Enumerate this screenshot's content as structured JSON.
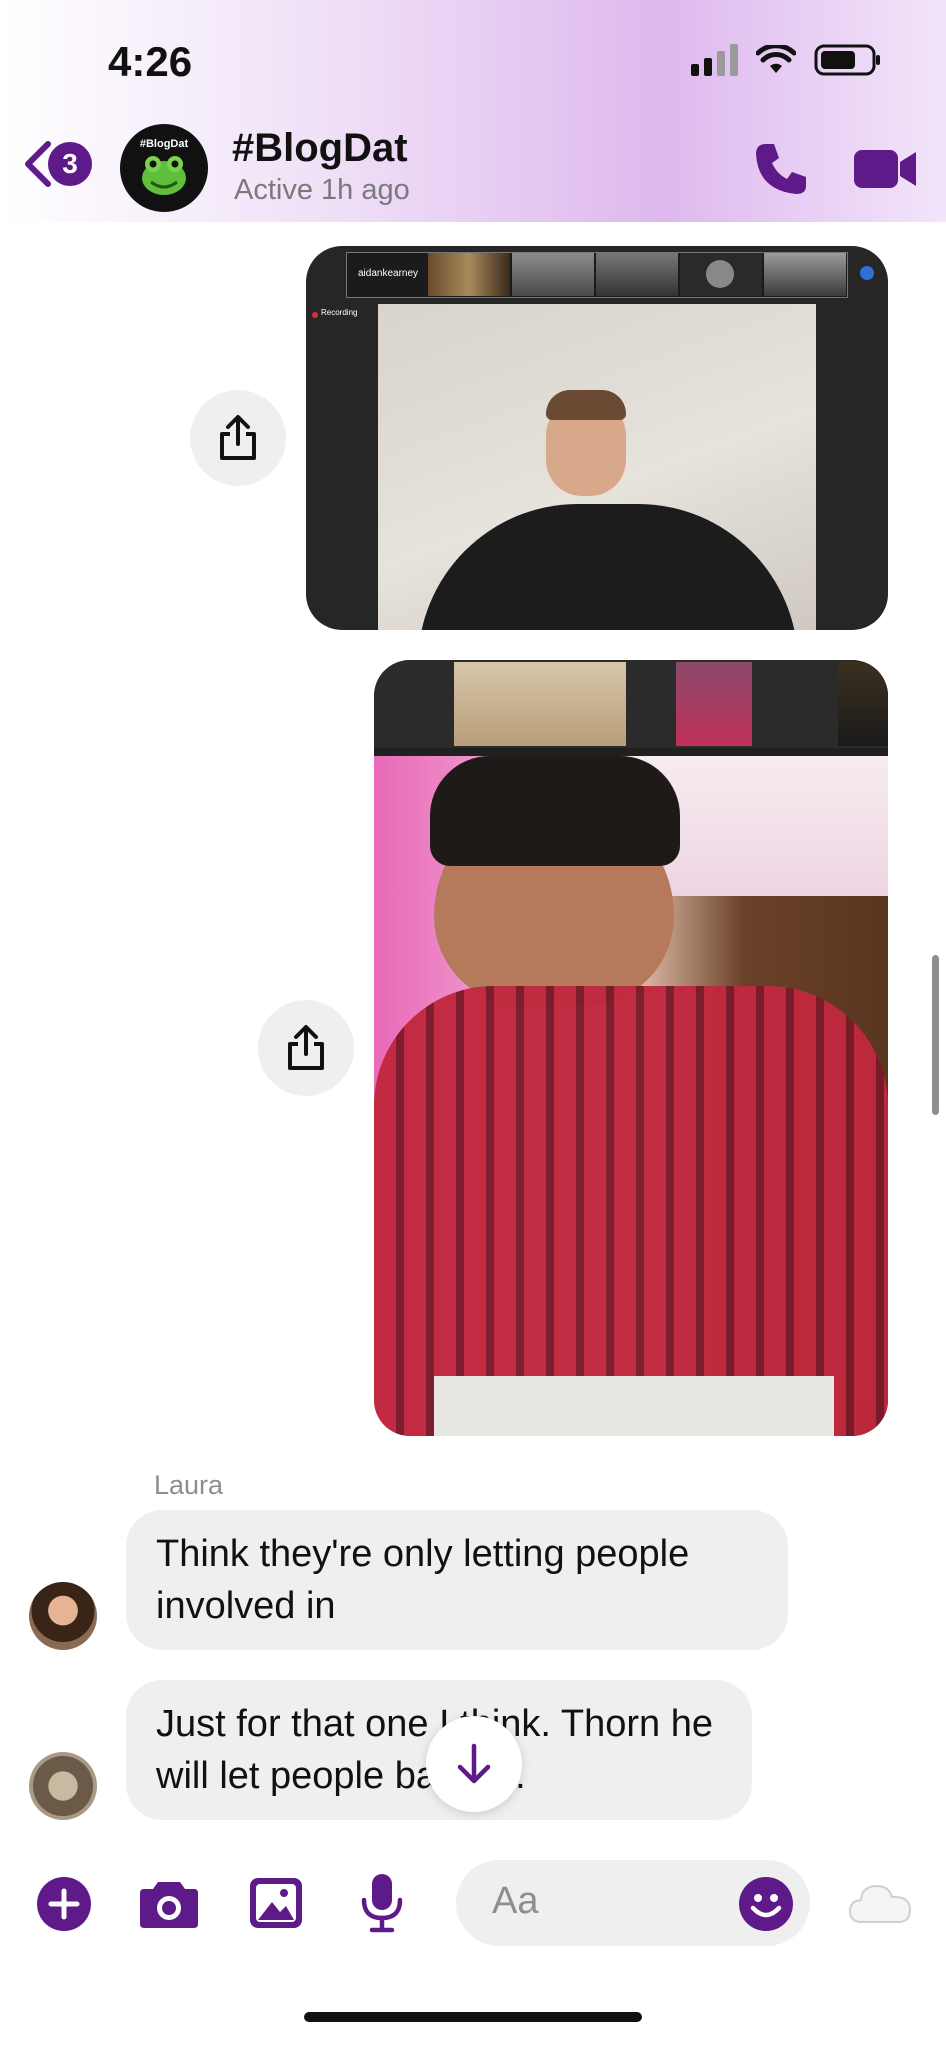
{
  "status_bar": {
    "time": "4:26"
  },
  "header": {
    "unread_count": "3",
    "avatar_text": "#BlogDat",
    "title": "#BlogDat",
    "subtitle": "Active 1h ago"
  },
  "media1": {
    "participant_label": "aidankearney",
    "recording_label": "Recording"
  },
  "messages": [
    {
      "sender": "Laura",
      "text": "Think they're only letting people involved in"
    },
    {
      "sender": "",
      "text": "Just for that one I think. Thorn he will let people back in."
    }
  ],
  "composer": {
    "placeholder": "Aa"
  },
  "colors": {
    "accent": "#5f1a8a",
    "bubble": "#efefef"
  }
}
